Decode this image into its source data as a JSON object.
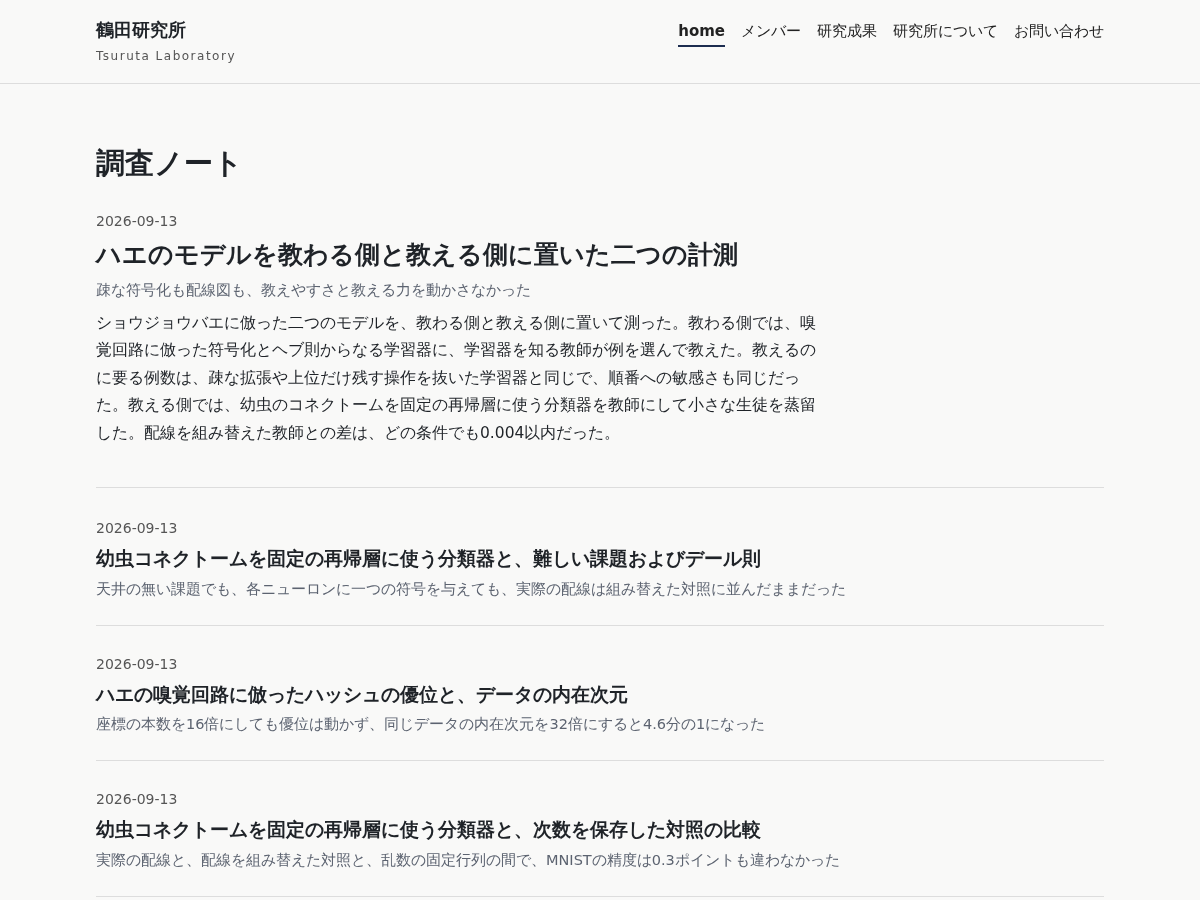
{
  "site": {
    "title": "鶴田研究所",
    "subtitle": "Tsuruta Laboratory"
  },
  "nav": [
    {
      "label": "home",
      "selected": true
    },
    {
      "label": "メンバー",
      "selected": false
    },
    {
      "label": "研究成果",
      "selected": false
    },
    {
      "label": "研究所について",
      "selected": false
    },
    {
      "label": "お問い合わせ",
      "selected": false
    }
  ],
  "page_title": "調査ノート",
  "posts": [
    {
      "kind": "featured",
      "date": "2026-09-13",
      "title": "ハエのモデルを教わる側と教える側に置いた二つの計測",
      "summary": "疎な符号化も配線図も、教えやすさと教える力を動かさなかった",
      "body": "ショウジョウバエに倣った二つのモデルを、教わる側と教える側に置いて測った。教わる側では、嗅覚回路に倣った符号化とヘブ則からなる学習器に、学習器を知る教師が例を選んで教えた。教えるのに要る例数は、疎な拡張や上位だけ残す操作を抜いた学習器と同じで、順番への敏感さも同じだった。教える側では、幼虫のコネクトームを固定の再帰層に使う分類器を教師にして小さな生徒を蒸留した。配線を組み替えた教師との差は、どの条件でも0.004以内だった。"
    },
    {
      "kind": "regular",
      "date": "2026-09-13",
      "title": "幼虫コネクトームを固定の再帰層に使う分類器と、難しい課題およびデール則",
      "summary": "天井の無い課題でも、各ニューロンに一つの符号を与えても、実際の配線は組み替えた対照に並んだままだった"
    },
    {
      "kind": "regular",
      "date": "2026-09-13",
      "title": "ハエの嗅覚回路に倣ったハッシュの優位と、データの内在次元",
      "summary": "座標の本数を16倍にしても優位は動かず、同じデータの内在次元を32倍にすると4.6分の1になった"
    },
    {
      "kind": "regular",
      "date": "2026-09-13",
      "title": "幼虫コネクトームを固定の再帰層に使う分類器と、次数を保存した対照の比較",
      "summary": "実際の配線と、配線を組み替えた対照と、乱数の固定行列の間で、MNISTの精度は0.3ポイントも違わなかった"
    }
  ]
}
